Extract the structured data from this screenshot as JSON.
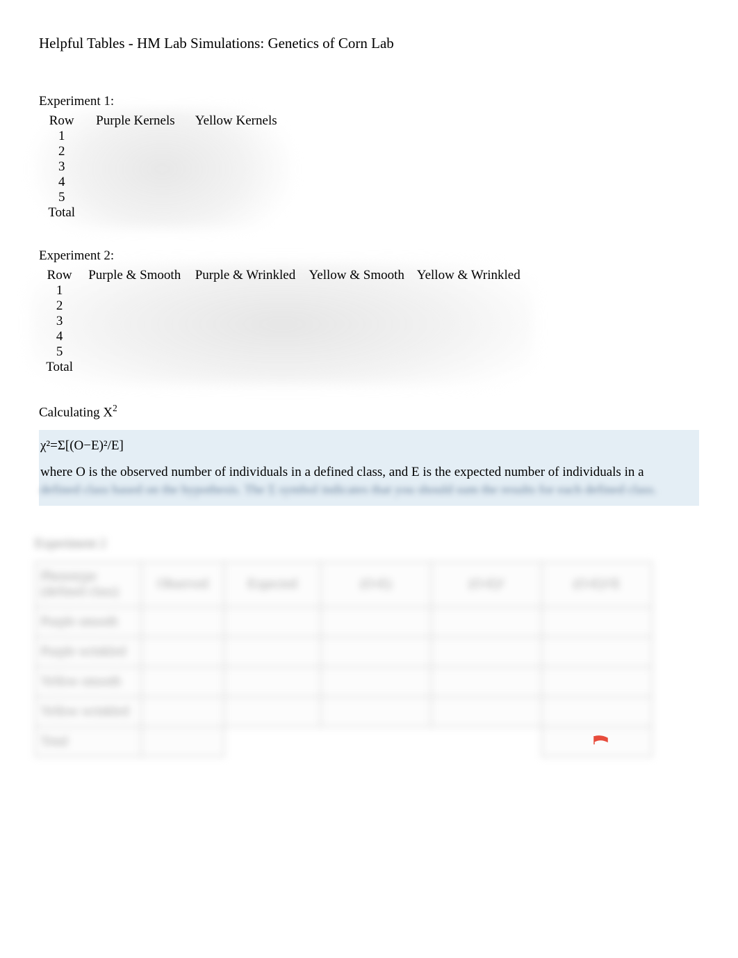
{
  "title": "Helpful Tables - HM Lab Simulations: Genetics of Corn Lab",
  "exp1": {
    "label": "Experiment 1:",
    "headers": [
      "Row",
      "Purple Kernels",
      "Yellow Kernels"
    ],
    "rows": [
      "1",
      "2",
      "3",
      "4",
      "5",
      "Total"
    ]
  },
  "exp2": {
    "label": "Experiment 2:",
    "headers": [
      "Row",
      "Purple & Smooth",
      "Purple & Wrinkled",
      "Yellow & Smooth",
      "Yellow & Wrinkled"
    ],
    "rows": [
      "1",
      "2",
      "3",
      "4",
      "5",
      "Total"
    ]
  },
  "calc": {
    "label_prefix": "Calculating X",
    "label_sup": "2",
    "formula": "χ²=Σ[(O−E)²/E]",
    "explain_pre": "where ",
    "explain_o": "O",
    "explain_mid1": " is the observed number of individuals in a defined class, and ",
    "explain_e": "E",
    "explain_mid2": " is the expected number of individuals in a",
    "explain_blurred": "defined class based on the hypothesis. The Σ symbol indicates that you should sum the results for each defined class."
  },
  "chi": {
    "section_label": "Experiment 2",
    "headers": [
      "Phenotype (defined class)",
      "Observed",
      "Expected",
      "(O-E)",
      "(O-E)²",
      "(O-E)²/E"
    ],
    "rows": [
      "Purple smooth",
      "Purple wrinkled",
      "Yellow smooth",
      "Yellow wrinkled",
      "Total"
    ]
  }
}
